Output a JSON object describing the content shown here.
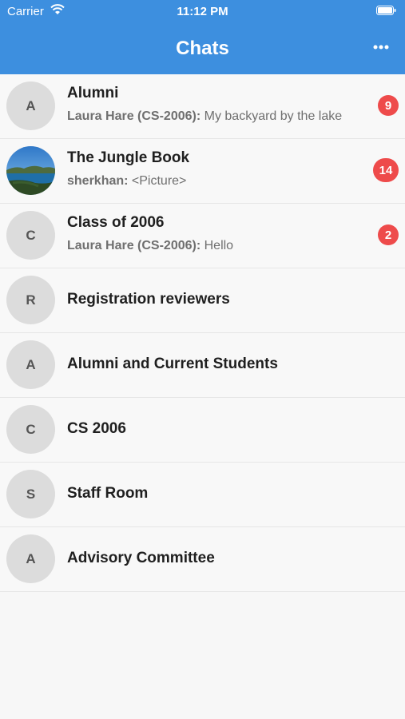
{
  "status_bar": {
    "carrier": "Carrier",
    "time": "11:12 PM"
  },
  "header": {
    "title": "Chats",
    "more_icon": "more-horizontal-icon"
  },
  "colors": {
    "header_bg": "#3d8fdf",
    "badge": "#ee4b4b",
    "avatar_bg": "#dcdcdc"
  },
  "chats": [
    {
      "name": "Alumni",
      "initial": "A",
      "preview_sender": "Laura Hare (CS-2006):",
      "preview_text": " My backyard by the lake",
      "unread": "9"
    },
    {
      "name": "The Jungle Book",
      "initial": "",
      "preview_sender": "sherkhan:",
      "preview_text": " <Picture>",
      "unread": "14"
    },
    {
      "name": "Class of 2006",
      "initial": "C",
      "preview_sender": "Laura Hare (CS-2006):",
      "preview_text": " Hello",
      "unread": "2"
    },
    {
      "name": "Registration reviewers",
      "initial": "R"
    },
    {
      "name": "Alumni and Current Students",
      "initial": "A"
    },
    {
      "name": "CS 2006",
      "initial": "C"
    },
    {
      "name": "Staff Room",
      "initial": "S"
    },
    {
      "name": "Advisory Committee",
      "initial": "A"
    }
  ]
}
